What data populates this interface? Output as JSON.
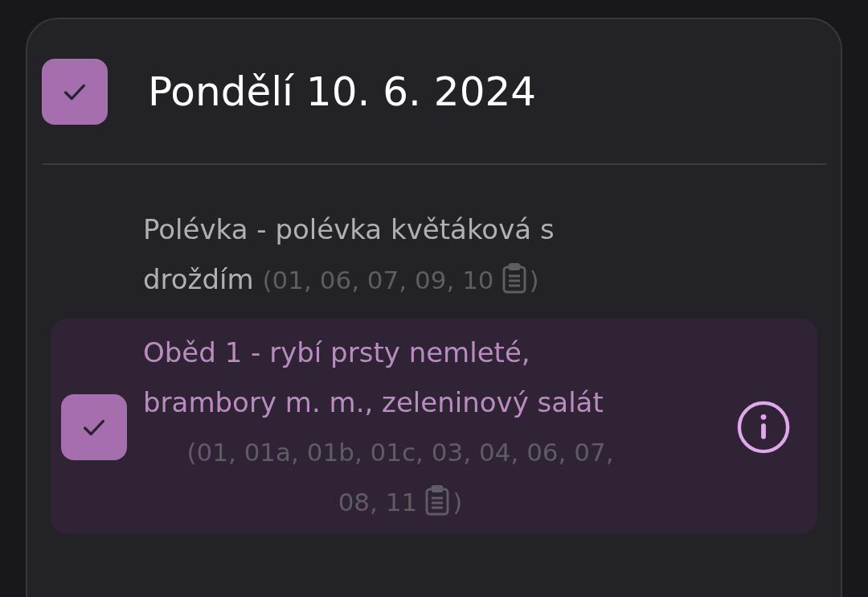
{
  "day": {
    "title": "Pondělí 10. 6. 2024",
    "checked": true
  },
  "meals": [
    {
      "kind": "inline",
      "text_lines": [
        "Polévka - polévka květáková s",
        "droždím"
      ],
      "allergen_lines": [
        "(01, 06, 07, 09, 10"
      ],
      "allergens_end": ")",
      "checked": false
    },
    {
      "kind": "below",
      "text_lines": [
        "Oběd 1 - rybí prsty nemleté, brambory m. m., zeleninový salát"
      ],
      "allergen_lines": [
        "(01, 01a, 01b, 01c, 03, 04, 06, 07,",
        "08, 11"
      ],
      "allergens_end": ")",
      "checked": true
    }
  ]
}
